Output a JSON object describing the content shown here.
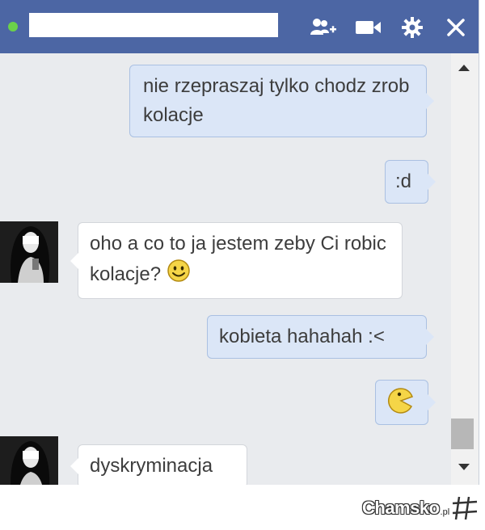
{
  "chat": {
    "messages": [
      {
        "direction": "out",
        "text": "nie rzepraszaj tylko chodz zrob kolacje"
      },
      {
        "direction": "out",
        "text": ":d"
      },
      {
        "direction": "in",
        "text": "oho a co to ja jestem zeby Ci robic kolacje?",
        "emoji": "smiley-icon"
      },
      {
        "direction": "out",
        "text": "kobieta hahahah :<"
      },
      {
        "direction": "out",
        "emoji": "pacman-icon"
      },
      {
        "direction": "in",
        "text": "dyskryminacja"
      }
    ]
  },
  "titlebar": {
    "status": "online",
    "status_color": "#6bd14a",
    "icons": [
      "add-friend-icon",
      "video-call-icon",
      "gear-icon",
      "close-icon"
    ]
  },
  "watermark": {
    "text": "Chamsko",
    "suffix": ".pl"
  },
  "colors": {
    "header": "#4c66a4",
    "outgoing_bubble": "#dbe6f7",
    "incoming_bubble": "#ffffff",
    "background": "#e9ebee"
  }
}
